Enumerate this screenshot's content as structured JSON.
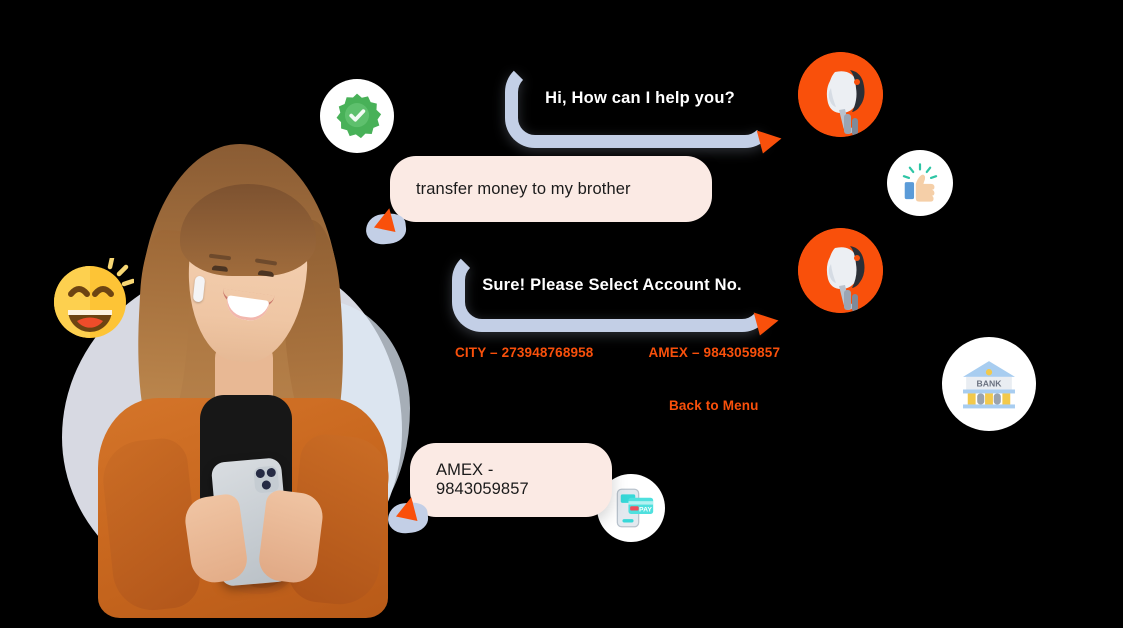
{
  "scene": {
    "background_color": "#000000",
    "accent_orange": "#f9500b",
    "bubble_bot_border": "#c3cfe6",
    "bubble_user_fill": "#fbeae4",
    "bot_text_color": "#ffffff",
    "user_text_color": "#1b1b1b"
  },
  "conversation": {
    "messages": [
      {
        "id": "bot-greeting",
        "sender": "bot",
        "text": "Hi, How can I help you?"
      },
      {
        "id": "user-request",
        "sender": "user",
        "text": "transfer money to my brother"
      },
      {
        "id": "bot-prompt",
        "sender": "bot",
        "text": "Sure! Please Select Account No."
      },
      {
        "id": "user-choice",
        "sender": "user",
        "text": "AMEX - 9843059857"
      }
    ],
    "quick_replies": [
      {
        "id": "city-account",
        "label": "CITY – 273948768958"
      },
      {
        "id": "amex-account",
        "label": "AMEX – 9843059857"
      }
    ],
    "back_to_menu": "Back to Menu"
  },
  "icons": {
    "verified_badge": "verified-check-icon",
    "robot_avatar_top": "robot-avatar-icon",
    "robot_avatar_mid": "robot-avatar-icon",
    "thumbs_up": "thumbs-up-icon",
    "bank": "bank-building-icon",
    "mobile_pay": "mobile-payment-icon",
    "laughing_emoji": "laughing-face-icon",
    "bank_label": "BANK",
    "pay_label": "PAY"
  },
  "person": {
    "alt": "smiling woman in orange shirt using smartphone"
  }
}
